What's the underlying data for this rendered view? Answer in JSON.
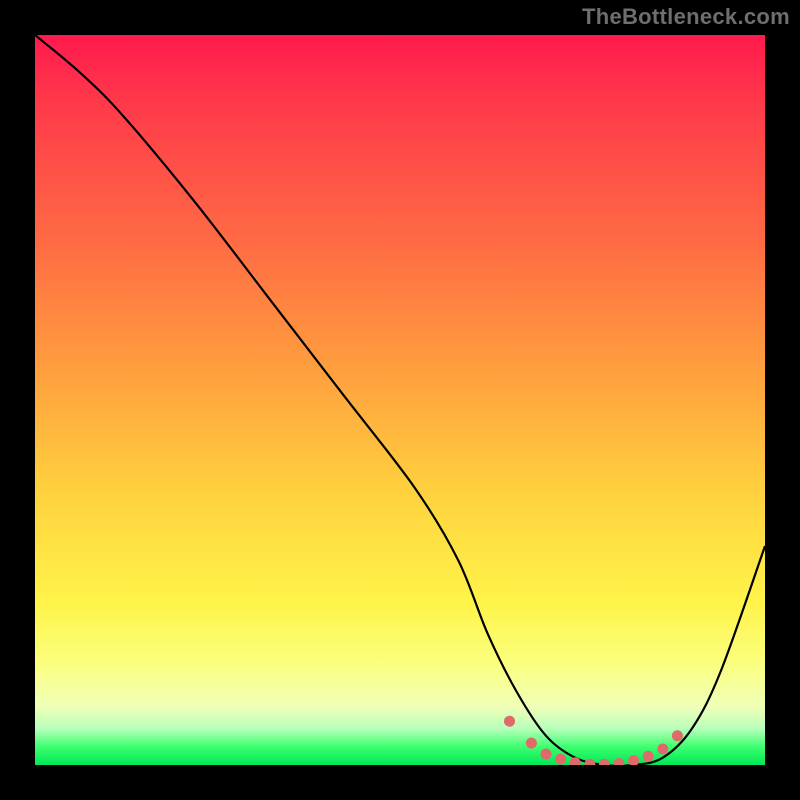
{
  "watermark": "TheBottleneck.com",
  "chart_data": {
    "type": "line",
    "title": "",
    "xlabel": "",
    "ylabel": "",
    "xlim": [
      0,
      100
    ],
    "ylim": [
      0,
      100
    ],
    "grid": false,
    "legend": false,
    "series": [
      {
        "name": "bottleneck-curve",
        "x": [
          0,
          6,
          12,
          22,
          32,
          42,
          52,
          58,
          62,
          66,
          70,
          74,
          78,
          82,
          86,
          90,
          94,
          100
        ],
        "y": [
          100,
          95,
          89,
          77,
          64,
          51,
          38,
          28,
          18,
          10,
          4,
          1,
          0,
          0,
          1,
          5,
          13,
          30
        ]
      }
    ],
    "markers": {
      "name": "optimal-zone-dots",
      "x": [
        65,
        68,
        70,
        72,
        74,
        76,
        78,
        80,
        82,
        84,
        86,
        88
      ],
      "y": [
        6,
        3,
        1.5,
        0.8,
        0.3,
        0.1,
        0.1,
        0.2,
        0.6,
        1.2,
        2.2,
        4
      ]
    },
    "background": {
      "type": "vertical-gradient",
      "stops": [
        {
          "pos": 0,
          "color": "#ff1a4d"
        },
        {
          "pos": 0.45,
          "color": "#ff9c3e"
        },
        {
          "pos": 0.78,
          "color": "#fff44a"
        },
        {
          "pos": 0.95,
          "color": "#b8ffbb"
        },
        {
          "pos": 1.0,
          "color": "#00e856"
        }
      ]
    }
  }
}
